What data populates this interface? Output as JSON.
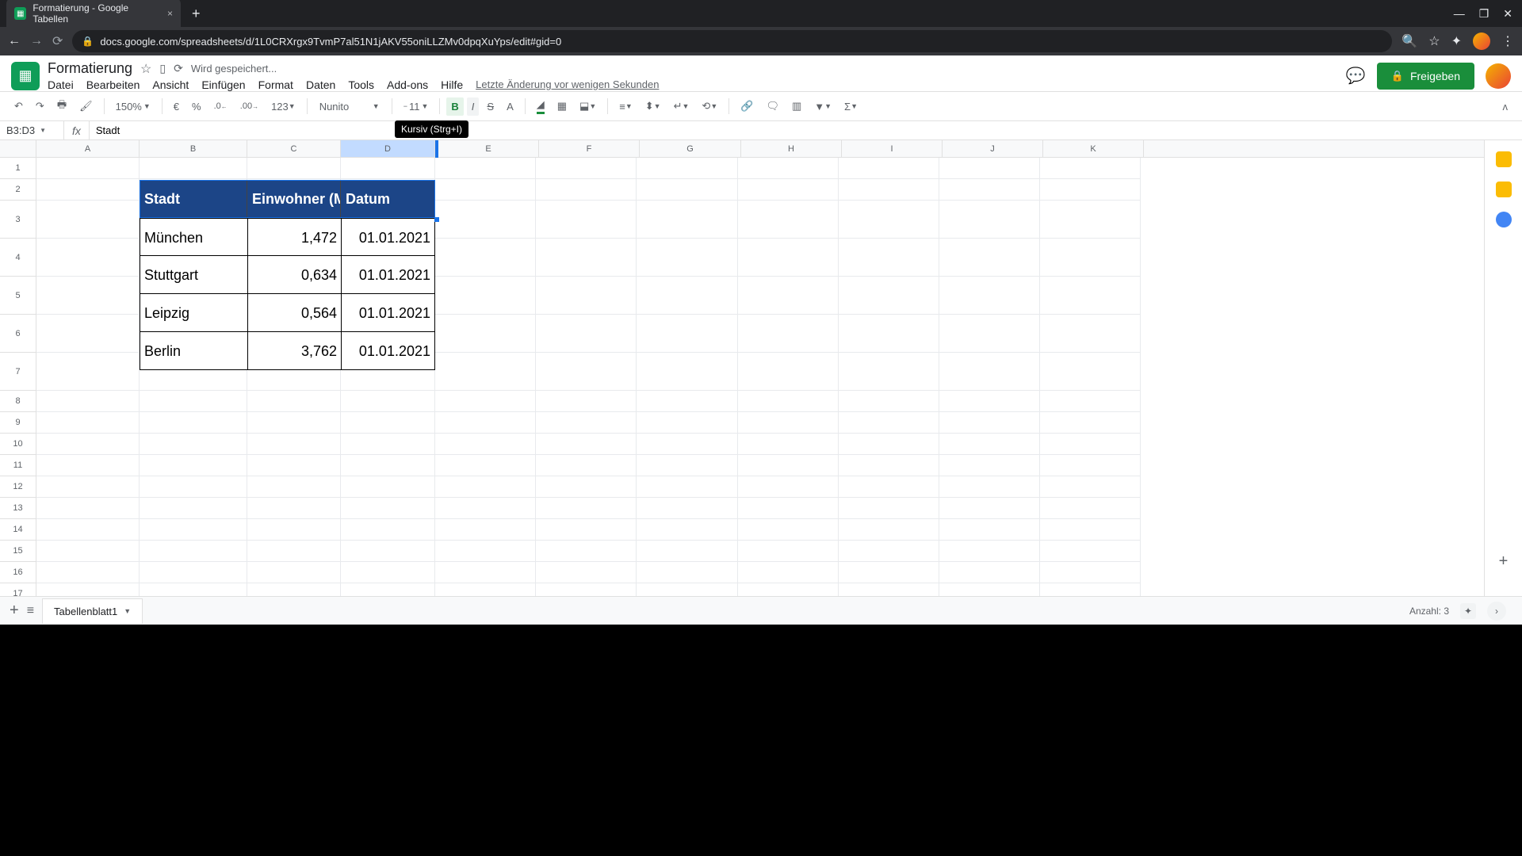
{
  "browser": {
    "tab_title": "Formatierung - Google Tabellen",
    "url": "docs.google.com/spreadsheets/d/1L0CRXrgx9TvmP7al51N1jAKV55oniLLZMv0dpqXuYps/edit#gid=0"
  },
  "header": {
    "doc_title": "Formatierung",
    "save_status": "Wird gespeichert...",
    "share_label": "Freigeben",
    "last_edit": "Letzte Änderung vor wenigen Sekunden"
  },
  "menus": {
    "file": "Datei",
    "edit": "Bearbeiten",
    "view": "Ansicht",
    "insert": "Einfügen",
    "format": "Format",
    "data": "Daten",
    "tools": "Tools",
    "addons": "Add-ons",
    "help": "Hilfe"
  },
  "toolbar": {
    "zoom": "150%",
    "currency": "€",
    "percent": "%",
    "dec_dec": ".0",
    "inc_dec": ".00",
    "num_format": "123",
    "font_name": "Nunito",
    "font_size": "11",
    "bold": "B",
    "italic": "I",
    "strike": "S",
    "tooltip": "Kursiv (Strg+I)"
  },
  "namebox": {
    "ref": "B3:D3",
    "fx_label": "fx",
    "formula_value": "Stadt"
  },
  "columns": [
    "A",
    "B",
    "C",
    "D",
    "E",
    "F",
    "G",
    "H",
    "I",
    "J",
    "K"
  ],
  "rows_count": 17,
  "table": {
    "headers": {
      "b": "Stadt",
      "c": "Einwohner (M",
      "d": "Datum"
    },
    "rows": [
      {
        "city": "München",
        "pop": "1,472",
        "date": "01.01.2021"
      },
      {
        "city": "Stuttgart",
        "pop": "0,634",
        "date": "01.01.2021"
      },
      {
        "city": "Leipzig",
        "pop": "0,564",
        "date": "01.01.2021"
      },
      {
        "city": "Berlin",
        "pop": "3,762",
        "date": "01.01.2021"
      }
    ]
  },
  "sheets": {
    "tab1": "Tabellenblatt1",
    "count_label": "Anzahl: 3"
  },
  "colors": {
    "header_bg": "#1c4587"
  }
}
